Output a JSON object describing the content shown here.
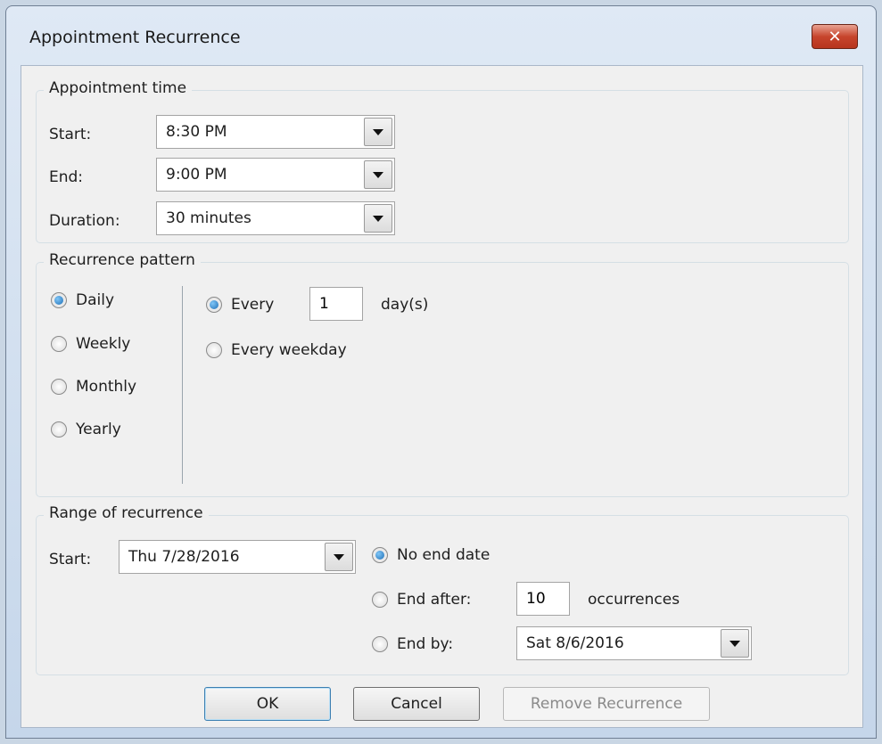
{
  "window": {
    "title": "Appointment Recurrence",
    "close_label": "✕"
  },
  "appointment_time": {
    "label": "Appointment time",
    "start_label": "Start:",
    "start_value": "8:30 PM",
    "end_label": "End:",
    "end_value": "9:00 PM",
    "duration_label": "Duration:",
    "duration_value": "30 minutes"
  },
  "recurrence_pattern": {
    "label": "Recurrence pattern",
    "options": [
      "Daily",
      "Weekly",
      "Monthly",
      "Yearly"
    ],
    "selected": "Daily",
    "every_label": "Every",
    "every_value": "1",
    "days_label": "day(s)",
    "every_weekday_label": "Every weekday"
  },
  "range": {
    "label": "Range of recurrence",
    "start_label": "Start:",
    "start_value": "Thu 7/28/2016",
    "no_end_label": "No end date",
    "end_after_label": "End after:",
    "end_after_value": "10",
    "occurrences_label": "occurrences",
    "end_by_label": "End by:",
    "end_by_value": "Sat 8/6/2016"
  },
  "buttons": {
    "ok": "OK",
    "cancel": "Cancel",
    "remove": "Remove Recurrence"
  }
}
